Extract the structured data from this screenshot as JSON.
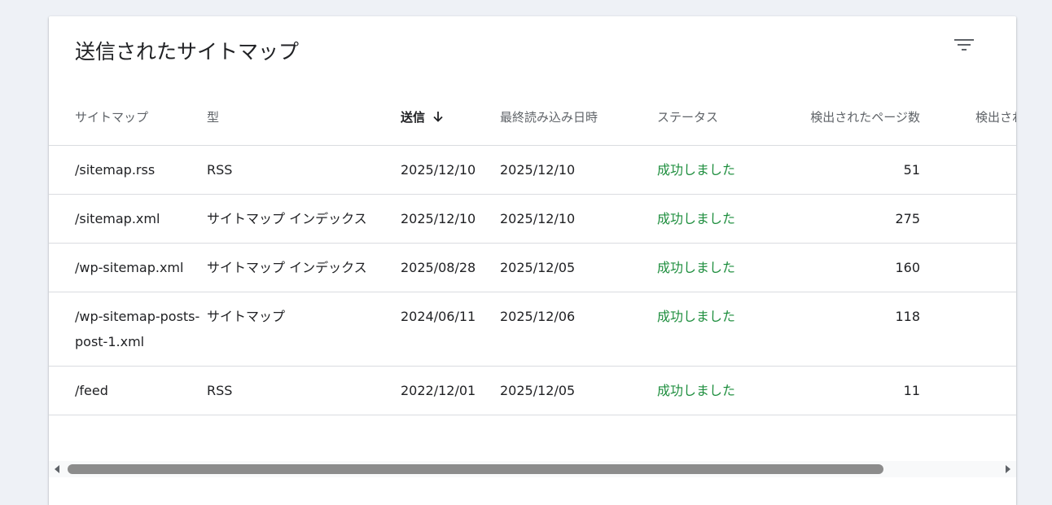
{
  "card": {
    "title": "送信されたサイトマップ"
  },
  "columns": [
    {
      "key": "sitemap",
      "label": "サイトマップ"
    },
    {
      "key": "type",
      "label": "型"
    },
    {
      "key": "submitted",
      "label": "送信",
      "sorted": "descending"
    },
    {
      "key": "last_read",
      "label": "最終読み込み日時"
    },
    {
      "key": "status",
      "label": "ステータス"
    },
    {
      "key": "pages",
      "label": "検出されたページ数"
    },
    {
      "key": "videos",
      "label": "検出された動画数"
    }
  ],
  "rows": [
    {
      "sitemap": "/sitemap.rss",
      "type": "RSS",
      "submitted": "2025/12/10",
      "last_read": "2025/12/10",
      "status": "成功しました",
      "pages": "51"
    },
    {
      "sitemap": "/sitemap.xml",
      "type": "サイトマップ インデックス",
      "submitted": "2025/12/10",
      "last_read": "2025/12/10",
      "status": "成功しました",
      "pages": "275"
    },
    {
      "sitemap": "/wp-sitemap.xml",
      "type": "サイトマップ インデックス",
      "submitted": "2025/08/28",
      "last_read": "2025/12/05",
      "status": "成功しました",
      "pages": "160"
    },
    {
      "sitemap": "/wp-sitemap-posts-post-1.xml",
      "type": "サイトマップ",
      "submitted": "2024/06/11",
      "last_read": "2025/12/06",
      "status": "成功しました",
      "pages": "118"
    },
    {
      "sitemap": "/feed",
      "type": "RSS",
      "submitted": "2022/12/01",
      "last_read": "2025/12/05",
      "status": "成功しました",
      "pages": "11"
    }
  ],
  "colors": {
    "status_success": "#1e8e3e",
    "background": "#eef1f6",
    "divider": "#dadce0"
  },
  "icons": {
    "filter": "filter-icon",
    "sort": "arrow-down-icon",
    "scroll_left": "scroll-left-arrow-icon",
    "scroll_right": "scroll-right-arrow-icon"
  }
}
